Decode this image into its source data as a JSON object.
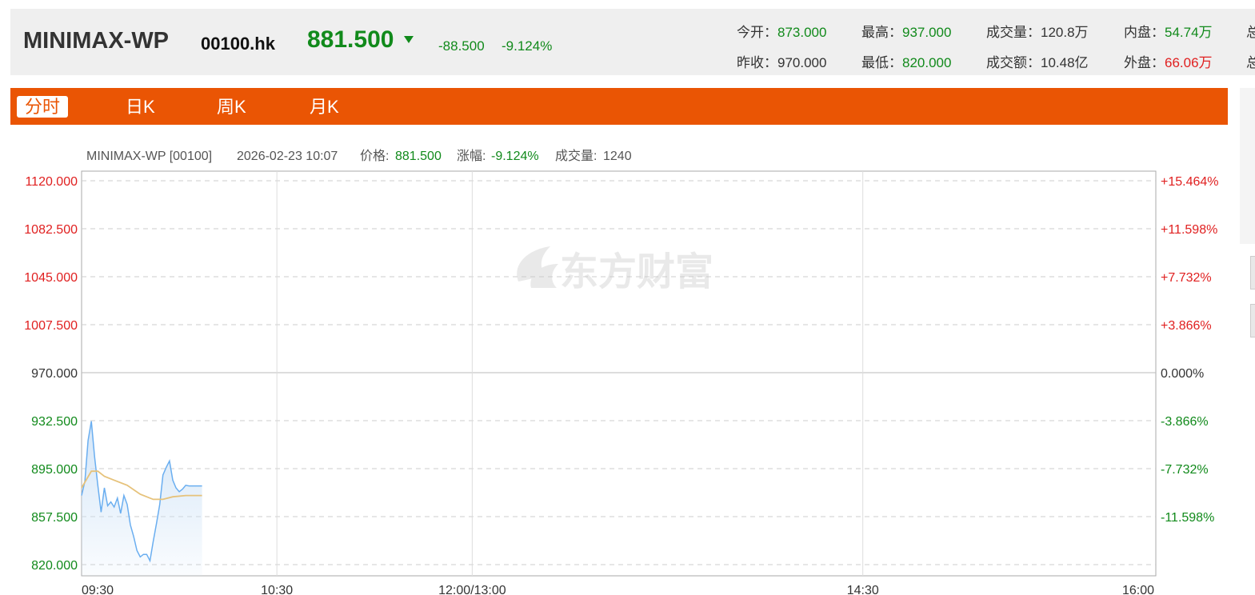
{
  "header": {
    "name": "MINIMAX-WP",
    "code": "00100.hk",
    "price": "881.500",
    "change": "-88.500",
    "change_pct": "-9.124%",
    "stats": [
      {
        "label": "今开：",
        "value": "873.000",
        "color": "green"
      },
      {
        "label": "最高：",
        "value": "937.000",
        "color": "green"
      },
      {
        "label": "成交量：",
        "value": "120.8万",
        "color": "black"
      },
      {
        "label": "内盘：",
        "value": "54.74万",
        "color": "green"
      },
      {
        "label": "昨收：",
        "value": "970.000",
        "color": "black"
      },
      {
        "label": "最低：",
        "value": "820.000",
        "color": "green"
      },
      {
        "label": "成交额：",
        "value": "10.48亿",
        "color": "black"
      },
      {
        "label": "外盘：",
        "value": "66.06万",
        "color": "red"
      }
    ],
    "clipped_label": "总"
  },
  "tabs": [
    {
      "label": "分时",
      "active": true
    },
    {
      "label": "日K",
      "active": false
    },
    {
      "label": "周K",
      "active": false
    },
    {
      "label": "月K",
      "active": false
    }
  ],
  "chart_info": {
    "name": "MINIMAX-WP [00100]",
    "datetime": "2026-02-23 10:07",
    "price_label": "价格:",
    "price": "881.500",
    "change_label": "涨幅:",
    "change": "-9.124%",
    "volume_label": "成交量:",
    "volume": "1240"
  },
  "watermark": "东方财富",
  "colors": {
    "accent": "#ea5504",
    "up": "#e02020",
    "down": "#118a1b",
    "price_line": "#6aaef0",
    "avg_line": "#e6c27a"
  },
  "chart_data": {
    "type": "line",
    "title": "",
    "xlabel": "",
    "ylabel": "",
    "y_ticks_left": [
      "1120.000",
      "1082.500",
      "1045.000",
      "1007.500",
      "970.000",
      "932.500",
      "895.000",
      "857.500",
      "820.000"
    ],
    "y_ticks_right": [
      "+15.464%",
      "+11.598%",
      "+7.732%",
      "+3.866%",
      "0.000%",
      "-3.866%",
      "-7.732%",
      "-11.598%",
      ""
    ],
    "x_ticks": [
      "09:30",
      "10:30",
      "12:00/13:00",
      "14:30",
      "16:00"
    ],
    "ylim": [
      820,
      1120
    ],
    "prev_close": 970,
    "session_minutes": 330,
    "series": [
      {
        "key": "price",
        "minutes": [
          0,
          1,
          2,
          3,
          4,
          5,
          6,
          7,
          8,
          9,
          10,
          11,
          12,
          13,
          14,
          15,
          16,
          17,
          18,
          19,
          20,
          21,
          22,
          23,
          24,
          25,
          26,
          27,
          28,
          29,
          30,
          31,
          32,
          33,
          34,
          35,
          36,
          37
        ],
        "values": [
          874,
          885,
          917,
          932,
          904,
          882,
          861,
          880,
          866,
          869,
          865,
          872,
          860,
          874,
          867,
          851,
          842,
          831,
          826,
          828,
          828,
          823,
          838,
          852,
          867,
          890,
          896,
          901,
          886,
          880,
          877,
          879,
          882,
          881.5,
          881.5,
          881.5,
          881.5,
          881.5
        ]
      },
      {
        "key": "average",
        "minutes": [
          0,
          3,
          5,
          7,
          10,
          14,
          18,
          22,
          25,
          28,
          32,
          37
        ],
        "values": [
          880,
          893,
          893,
          889,
          886,
          882,
          875,
          871,
          871,
          873,
          874,
          874
        ]
      }
    ]
  }
}
